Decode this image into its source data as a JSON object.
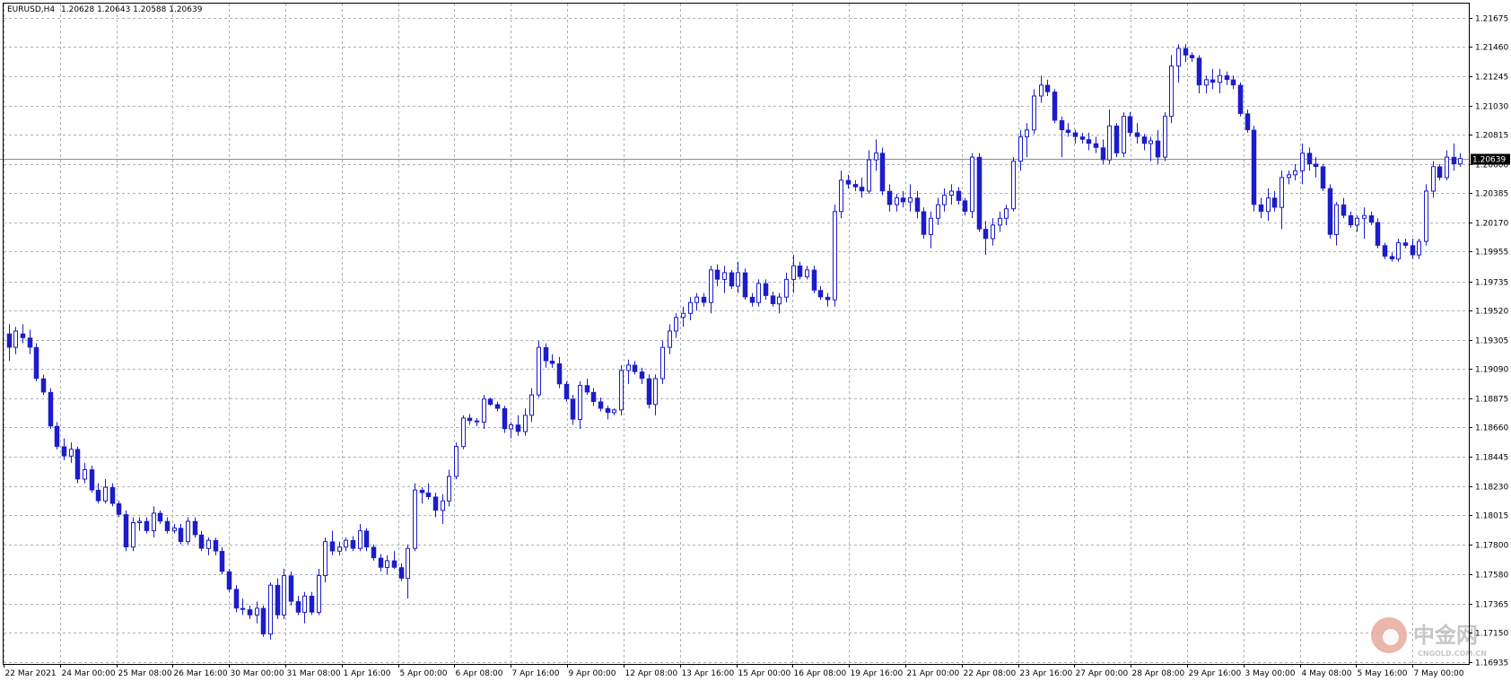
{
  "header": {
    "symbol": "EURUSD,H4",
    "ohlc": "1.20628 1.20643 1.20588 1.20639"
  },
  "current_price_label": "1.20639",
  "watermark": {
    "title": "中金网",
    "url": "CNGOLD.COM.CN"
  },
  "colors": {
    "background": "#ffffff",
    "candle": "#1c1cc8",
    "grid": "#a7b3b8",
    "axis": "#000000",
    "price_line": "#8c8c8c",
    "price_label_bg": "#000000",
    "price_label_fg": "#ffffff"
  },
  "chart_data": {
    "type": "candlestick",
    "symbol": "EURUSD",
    "timeframe": "H4",
    "current_price": 1.20639,
    "ylim": [
      1.1692,
      1.2178
    ],
    "y_ticks": [
      "1.21675",
      "1.21460",
      "1.21245",
      "1.21030",
      "1.20815",
      "1.20600",
      "1.20385",
      "1.20170",
      "1.19955",
      "1.19735",
      "1.19520",
      "1.19305",
      "1.19090",
      "1.18875",
      "1.18660",
      "1.18445",
      "1.18230",
      "1.18015",
      "1.17800",
      "1.17580",
      "1.17365",
      "1.17150",
      "1.16935"
    ],
    "x_ticks": [
      "22 Mar 2021",
      "24 Mar 00:00",
      "25 Mar 08:00",
      "26 Mar 16:00",
      "30 Mar 00:00",
      "31 Mar 08:00",
      "1 Apr 16:00",
      "5 Apr 00:00",
      "6 Apr 08:00",
      "7 Apr 16:00",
      "9 Apr 00:00",
      "12 Apr 08:00",
      "13 Apr 16:00",
      "15 Apr 00:00",
      "16 Apr 08:00",
      "19 Apr 16:00",
      "21 Apr 00:00",
      "22 Apr 08:00",
      "23 Apr 16:00",
      "27 Apr 00:00",
      "28 Apr 08:00",
      "29 Apr 16:00",
      "3 May 00:00",
      "4 May 08:00",
      "5 May 16:00",
      "7 May 00:00"
    ],
    "candles": [
      [
        1.1935,
        1.1942,
        1.1915,
        1.1925
      ],
      [
        1.1925,
        1.194,
        1.192,
        1.1937
      ],
      [
        1.1935,
        1.1942,
        1.1928,
        1.1932
      ],
      [
        1.1932,
        1.1938,
        1.192,
        1.1925
      ],
      [
        1.1925,
        1.1928,
        1.19,
        1.1902
      ],
      [
        1.1902,
        1.1905,
        1.189,
        1.1892
      ],
      [
        1.1892,
        1.1895,
        1.1865,
        1.1867
      ],
      [
        1.1867,
        1.187,
        1.185,
        1.1852
      ],
      [
        1.1852,
        1.1858,
        1.1842,
        1.1845
      ],
      [
        1.1845,
        1.1855,
        1.184,
        1.185
      ],
      [
        1.185,
        1.1852,
        1.1825,
        1.1828
      ],
      [
        1.1828,
        1.184,
        1.1825,
        1.1835
      ],
      [
        1.1835,
        1.1838,
        1.1818,
        1.182
      ],
      [
        1.182,
        1.1825,
        1.181,
        1.1812
      ],
      [
        1.1812,
        1.1828,
        1.181,
        1.1822
      ],
      [
        1.1822,
        1.1825,
        1.1808,
        1.181
      ],
      [
        1.181,
        1.1812,
        1.18,
        1.1802
      ],
      [
        1.1802,
        1.1805,
        1.1775,
        1.1778
      ],
      [
        1.1778,
        1.18,
        1.1775,
        1.1796
      ],
      [
        1.1796,
        1.18,
        1.179,
        1.1797
      ],
      [
        1.1797,
        1.18,
        1.1788,
        1.179
      ],
      [
        1.179,
        1.1808,
        1.1785,
        1.1803
      ],
      [
        1.1803,
        1.1805,
        1.1795,
        1.1797
      ],
      [
        1.1797,
        1.18,
        1.1788,
        1.179
      ],
      [
        1.179,
        1.1795,
        1.1788,
        1.1792
      ],
      [
        1.1792,
        1.1795,
        1.178,
        1.1782
      ],
      [
        1.1782,
        1.18,
        1.178,
        1.1797
      ],
      [
        1.1797,
        1.18,
        1.1785,
        1.1787
      ],
      [
        1.1787,
        1.179,
        1.1775,
        1.1777
      ],
      [
        1.1777,
        1.1785,
        1.1772,
        1.1783
      ],
      [
        1.1783,
        1.1785,
        1.1772,
        1.1775
      ],
      [
        1.1775,
        1.1778,
        1.1758,
        1.176
      ],
      [
        1.176,
        1.1762,
        1.1745,
        1.1747
      ],
      [
        1.1747,
        1.175,
        1.173,
        1.1733
      ],
      [
        1.1733,
        1.174,
        1.1728,
        1.1732
      ],
      [
        1.1732,
        1.1735,
        1.1725,
        1.1728
      ],
      [
        1.1728,
        1.1738,
        1.1722,
        1.1733
      ],
      [
        1.1733,
        1.1735,
        1.1712,
        1.1714
      ],
      [
        1.1714,
        1.1752,
        1.171,
        1.175
      ],
      [
        1.175,
        1.1755,
        1.1725,
        1.1728
      ],
      [
        1.1728,
        1.1762,
        1.1725,
        1.1757
      ],
      [
        1.1757,
        1.176,
        1.1735,
        1.1738
      ],
      [
        1.1738,
        1.1742,
        1.1728,
        1.173
      ],
      [
        1.173,
        1.1745,
        1.1722,
        1.1742
      ],
      [
        1.1742,
        1.1745,
        1.1728,
        1.173
      ],
      [
        1.173,
        1.1762,
        1.1728,
        1.1757
      ],
      [
        1.1757,
        1.1785,
        1.1752,
        1.1782
      ],
      [
        1.1782,
        1.179,
        1.1772,
        1.1775
      ],
      [
        1.1775,
        1.1782,
        1.1772,
        1.1778
      ],
      [
        1.1778,
        1.1785,
        1.1775,
        1.1783
      ],
      [
        1.1783,
        1.1786,
        1.1775,
        1.1777
      ],
      [
        1.1777,
        1.1795,
        1.1775,
        1.179
      ],
      [
        1.179,
        1.1792,
        1.1775,
        1.1778
      ],
      [
        1.1778,
        1.178,
        1.1768,
        1.177
      ],
      [
        1.177,
        1.1773,
        1.176,
        1.1763
      ],
      [
        1.1763,
        1.1772,
        1.1758,
        1.1768
      ],
      [
        1.1768,
        1.1775,
        1.1762,
        1.1763
      ],
      [
        1.1763,
        1.1766,
        1.1753,
        1.1755
      ],
      [
        1.1755,
        1.178,
        1.174,
        1.1777
      ],
      [
        1.1777,
        1.1825,
        1.1775,
        1.182
      ],
      [
        1.182,
        1.1822,
        1.181,
        1.1818
      ],
      [
        1.1818,
        1.1825,
        1.1813,
        1.1815
      ],
      [
        1.1815,
        1.1818,
        1.18,
        1.1805
      ],
      [
        1.1805,
        1.1817,
        1.1795,
        1.1812
      ],
      [
        1.1812,
        1.1835,
        1.1808,
        1.183
      ],
      [
        1.183,
        1.1855,
        1.1828,
        1.1852
      ],
      [
        1.1852,
        1.1875,
        1.185,
        1.1873
      ],
      [
        1.1873,
        1.1876,
        1.1868,
        1.1871
      ],
      [
        1.1871,
        1.1873,
        1.1867,
        1.187
      ],
      [
        1.187,
        1.189,
        1.1865,
        1.1887
      ],
      [
        1.1887,
        1.1888,
        1.1882,
        1.1883
      ],
      [
        1.1883,
        1.1885,
        1.1878,
        1.188
      ],
      [
        1.188,
        1.1882,
        1.1862,
        1.1865
      ],
      [
        1.1865,
        1.187,
        1.1858,
        1.1868
      ],
      [
        1.1868,
        1.1875,
        1.186,
        1.1863
      ],
      [
        1.1863,
        1.188,
        1.186,
        1.1875
      ],
      [
        1.1875,
        1.1895,
        1.187,
        1.189
      ],
      [
        1.189,
        1.193,
        1.1888,
        1.1925
      ],
      [
        1.1925,
        1.1928,
        1.191,
        1.1915
      ],
      [
        1.1915,
        1.192,
        1.191,
        1.1913
      ],
      [
        1.1913,
        1.1918,
        1.1895,
        1.1898
      ],
      [
        1.1898,
        1.19,
        1.1885,
        1.1887
      ],
      [
        1.1887,
        1.189,
        1.1868,
        1.1872
      ],
      [
        1.1872,
        1.19,
        1.1865,
        1.1897
      ],
      [
        1.1897,
        1.1902,
        1.189,
        1.1892
      ],
      [
        1.1892,
        1.1895,
        1.1882,
        1.1885
      ],
      [
        1.1885,
        1.1888,
        1.1878,
        1.188
      ],
      [
        1.188,
        1.1882,
        1.1872,
        1.1877
      ],
      [
        1.1877,
        1.188,
        1.1875,
        1.1879
      ],
      [
        1.1879,
        1.1912,
        1.1875,
        1.1908
      ],
      [
        1.1908,
        1.1916,
        1.1898,
        1.1912
      ],
      [
        1.1912,
        1.1915,
        1.1905,
        1.1907
      ],
      [
        1.1907,
        1.191,
        1.1898,
        1.1902
      ],
      [
        1.1902,
        1.1905,
        1.188,
        1.1883
      ],
      [
        1.1883,
        1.1905,
        1.1875,
        1.1902
      ],
      [
        1.1902,
        1.193,
        1.1898,
        1.1925
      ],
      [
        1.1925,
        1.1942,
        1.192,
        1.1937
      ],
      [
        1.1937,
        1.195,
        1.1932,
        1.1947
      ],
      [
        1.1947,
        1.1955,
        1.194,
        1.195
      ],
      [
        1.195,
        1.1962,
        1.1945,
        1.1958
      ],
      [
        1.1958,
        1.1965,
        1.1952,
        1.1962
      ],
      [
        1.1962,
        1.1965,
        1.1955,
        1.1958
      ],
      [
        1.1958,
        1.1985,
        1.195,
        1.1982
      ],
      [
        1.1982,
        1.1986,
        1.197,
        1.1975
      ],
      [
        1.1975,
        1.1985,
        1.1965,
        1.198
      ],
      [
        1.198,
        1.1982,
        1.1968,
        1.197
      ],
      [
        1.197,
        1.1988,
        1.1965,
        1.198
      ],
      [
        1.198,
        1.1983,
        1.196,
        1.1962
      ],
      [
        1.1962,
        1.1965,
        1.1955,
        1.1958
      ],
      [
        1.1958,
        1.1975,
        1.1955,
        1.1972
      ],
      [
        1.1972,
        1.1975,
        1.196,
        1.1963
      ],
      [
        1.1963,
        1.1966,
        1.1955,
        1.1957
      ],
      [
        1.1957,
        1.1965,
        1.195,
        1.1962
      ],
      [
        1.1962,
        1.198,
        1.1958,
        1.1975
      ],
      [
        1.1975,
        1.1993,
        1.1965,
        1.1985
      ],
      [
        1.1985,
        1.1988,
        1.1975,
        1.1977
      ],
      [
        1.1977,
        1.1985,
        1.1975,
        1.1982
      ],
      [
        1.1982,
        1.1985,
        1.1965,
        1.1967
      ],
      [
        1.1967,
        1.197,
        1.196,
        1.1962
      ],
      [
        1.1962,
        1.1965,
        1.1955,
        1.196
      ],
      [
        1.196,
        1.203,
        1.1955,
        1.2025
      ],
      [
        1.2025,
        1.2055,
        1.202,
        1.2048
      ],
      [
        1.2048,
        1.2052,
        1.2042,
        1.2045
      ],
      [
        1.2045,
        1.2048,
        1.204,
        1.2043
      ],
      [
        1.2043,
        1.205,
        1.2035,
        1.204
      ],
      [
        1.204,
        1.207,
        1.2038,
        1.2063
      ],
      [
        1.2063,
        1.2078,
        1.2055,
        1.2068
      ],
      [
        1.2068,
        1.2072,
        1.2037,
        1.204
      ],
      [
        1.204,
        1.2045,
        1.2025,
        1.203
      ],
      [
        1.203,
        1.2038,
        1.2025,
        1.2035
      ],
      [
        1.2035,
        1.204,
        1.2028,
        1.2032
      ],
      [
        1.2032,
        1.2045,
        1.2025,
        1.2035
      ],
      [
        1.2035,
        1.204,
        1.202,
        1.2025
      ],
      [
        1.2025,
        1.2028,
        1.2005,
        1.2008
      ],
      [
        1.2008,
        1.2025,
        1.1998,
        1.202
      ],
      [
        1.202,
        1.2035,
        1.2015,
        1.203
      ],
      [
        1.203,
        1.2042,
        1.2025,
        1.2037
      ],
      [
        1.2037,
        1.2045,
        1.203,
        1.204
      ],
      [
        1.204,
        1.2043,
        1.203,
        1.2033
      ],
      [
        1.2033,
        1.2035,
        1.2022,
        1.2025
      ],
      [
        1.2025,
        1.2068,
        1.202,
        1.2065
      ],
      [
        1.2065,
        1.2068,
        1.201,
        1.2012
      ],
      [
        1.2012,
        1.2018,
        1.1993,
        1.2005
      ],
      [
        1.2005,
        1.202,
        1.2,
        1.2015
      ],
      [
        1.2015,
        1.2025,
        1.201,
        1.202
      ],
      [
        1.202,
        1.203,
        1.2015,
        1.2027
      ],
      [
        1.2027,
        1.2065,
        1.2025,
        1.2062
      ],
      [
        1.2062,
        1.2085,
        1.2055,
        1.208
      ],
      [
        1.208,
        1.209,
        1.2065,
        1.2085
      ],
      [
        1.2085,
        1.2115,
        1.2082,
        1.211
      ],
      [
        1.211,
        1.2125,
        1.2105,
        1.2118
      ],
      [
        1.2118,
        1.2122,
        1.211,
        1.2113
      ],
      [
        1.2113,
        1.2115,
        1.209,
        1.2092
      ],
      [
        1.2092,
        1.2095,
        1.2065,
        1.2085
      ],
      [
        1.2085,
        1.209,
        1.208,
        1.2083
      ],
      [
        1.2083,
        1.2085,
        1.2075,
        1.208
      ],
      [
        1.208,
        1.2083,
        1.2075,
        1.2078
      ],
      [
        1.2078,
        1.2083,
        1.207,
        1.2075
      ],
      [
        1.2075,
        1.208,
        1.2068,
        1.2072
      ],
      [
        1.2072,
        1.2078,
        1.206,
        1.2063
      ],
      [
        1.2063,
        1.21,
        1.206,
        1.2088
      ],
      [
        1.2088,
        1.209,
        1.2065,
        1.2068
      ],
      [
        1.2068,
        1.2098,
        1.2065,
        1.2095
      ],
      [
        1.2095,
        1.2098,
        1.208,
        1.2083
      ],
      [
        1.2083,
        1.209,
        1.2075,
        1.208
      ],
      [
        1.208,
        1.2082,
        1.207,
        1.2075
      ],
      [
        1.2075,
        1.208,
        1.2062,
        1.2077
      ],
      [
        1.2077,
        1.2085,
        1.206,
        1.2065
      ],
      [
        1.2065,
        1.2098,
        1.2062,
        1.2095
      ],
      [
        1.2095,
        1.214,
        1.209,
        1.2132
      ],
      [
        1.2132,
        1.2148,
        1.212,
        1.2145
      ],
      [
        1.2145,
        1.2148,
        1.2135,
        1.214
      ],
      [
        1.214,
        1.2142,
        1.2135,
        1.2138
      ],
      [
        1.2138,
        1.214,
        1.2112,
        1.2118
      ],
      [
        1.2118,
        1.2125,
        1.2112,
        1.2122
      ],
      [
        1.2122,
        1.213,
        1.2115,
        1.212
      ],
      [
        1.212,
        1.213,
        1.2112,
        1.2125
      ],
      [
        1.2125,
        1.2128,
        1.2118,
        1.2122
      ],
      [
        1.2122,
        1.2125,
        1.2115,
        1.2118
      ],
      [
        1.2118,
        1.212,
        1.2095,
        1.2097
      ],
      [
        1.2097,
        1.21,
        1.2083,
        1.2085
      ],
      [
        1.2085,
        1.2088,
        1.2025,
        1.203
      ],
      [
        1.203,
        1.2035,
        1.202,
        1.2025
      ],
      [
        1.2025,
        1.2042,
        1.2018,
        1.2035
      ],
      [
        1.2035,
        1.204,
        1.2025,
        1.2028
      ],
      [
        1.2028,
        1.2055,
        1.2012,
        1.205
      ],
      [
        1.205,
        1.2055,
        1.2045,
        1.2052
      ],
      [
        1.2052,
        1.206,
        1.2048,
        1.2055
      ],
      [
        1.2055,
        1.2075,
        1.2045,
        1.2068
      ],
      [
        1.2068,
        1.2072,
        1.2055,
        1.206
      ],
      [
        1.206,
        1.2065,
        1.205,
        1.2058
      ],
      [
        1.2058,
        1.206,
        1.204,
        1.2042
      ],
      [
        1.2042,
        1.2045,
        1.2005,
        1.2008
      ],
      [
        1.2008,
        1.2032,
        1.2,
        1.203
      ],
      [
        1.203,
        1.2035,
        1.202,
        1.2022
      ],
      [
        1.2022,
        1.2025,
        1.2013,
        1.2015
      ],
      [
        1.2015,
        1.2022,
        1.201,
        1.202
      ],
      [
        1.202,
        1.2028,
        1.2005,
        1.2022
      ],
      [
        1.2022,
        1.2025,
        1.2015,
        1.2017
      ],
      [
        1.2017,
        1.202,
        1.1998,
        1.2
      ],
      [
        1.2,
        1.2002,
        1.199,
        1.1992
      ],
      [
        1.1992,
        1.1995,
        1.1988,
        1.199
      ],
      [
        1.199,
        1.2005,
        1.1988,
        1.2002
      ],
      [
        1.2002,
        1.2005,
        1.1998,
        1.2
      ],
      [
        1.2,
        1.2005,
        1.199,
        1.1993
      ],
      [
        1.1993,
        1.2005,
        1.199,
        1.2003
      ],
      [
        1.2003,
        1.2045,
        1.2,
        1.204
      ],
      [
        1.204,
        1.2062,
        1.2035,
        1.2058
      ],
      [
        1.2058,
        1.206,
        1.2048,
        1.205
      ],
      [
        1.205,
        1.207,
        1.2048,
        1.2065
      ],
      [
        1.2065,
        1.2075,
        1.2055,
        1.206
      ],
      [
        1.206,
        1.2068,
        1.2058,
        1.2064
      ]
    ]
  }
}
